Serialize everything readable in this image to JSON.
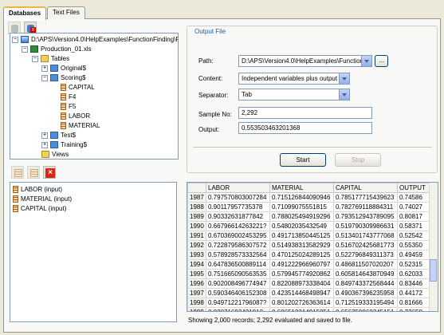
{
  "tabs": [
    {
      "label": "Databases",
      "active": true
    },
    {
      "label": "Text Files",
      "active": false
    }
  ],
  "tree": {
    "root": "D:\\APS\\Version4.0\\HelpExamples\\FunctionFinding\\Pro",
    "file": "Production_01.xls",
    "tables_label": "Tables",
    "tables": [
      "Original$",
      "Scoring$"
    ],
    "scoring_columns": [
      "CAPITAL",
      "F4",
      "F5",
      "LABOR",
      "MATERIAL"
    ],
    "more_tables": [
      "Test$",
      "Training$"
    ],
    "views_label": "Views"
  },
  "variables": [
    "LABOR (input)",
    "MATERIAL (input)",
    "CAPITAL (input)"
  ],
  "output_file": {
    "title": "Output File",
    "path_label": "Path:",
    "path_value": "D:\\APS\\Version4.0\\HelpExamples\\FunctionF",
    "browse_label": "...",
    "content_label": "Content:",
    "content_value": "Independent variables plus output",
    "separator_label": "Separator:",
    "separator_value": "Tab",
    "sample_label": "Sample No:",
    "sample_value": "2,292",
    "output_label": "Output:",
    "output_value": "0.553503463201368",
    "start_label": "Start",
    "stop_label": "Stop"
  },
  "grid": {
    "columns": [
      "",
      "LABOR",
      "MATERIAL",
      "CAPITAL",
      "OUTPUT"
    ],
    "rows": [
      [
        "1987",
        "0.797570803007284",
        "0.715126844090946",
        "0.785177715439623",
        "0.74586"
      ],
      [
        "1988",
        "0.90117957735378",
        "0.71099075551815",
        "0.782769118884311",
        "0.74027"
      ],
      [
        "1989",
        "0.90332631877842",
        "0.788025494919296",
        "0.793512943789095",
        "0.80817"
      ],
      [
        "1990",
        "0.66796614263221?",
        "0.54802035432549",
        "0.519790309986631",
        "0.58371"
      ],
      [
        "1991",
        "0.670369002453295",
        "0.491713850445125",
        "0.513401743777068",
        "0.52542"
      ],
      [
        "1992",
        "0.722879586307572",
        "0.514938313582929",
        "0.516702425681773",
        "0.55350"
      ],
      [
        "1993",
        "0.578928573332564",
        "0.470125024289125",
        "0.522796849311373",
        "0.49459"
      ],
      [
        "1994",
        "0.647836500889114",
        "0.491222966960797",
        "0.486811507020207",
        "0.52315"
      ],
      [
        "1995",
        "0.751665090563535",
        "0.579945774920862",
        "0.605814643870949",
        "0.62033"
      ],
      [
        "1996",
        "0.902008496774947",
        "0.822088973338404",
        "0.849743372568444",
        "0.83446"
      ],
      [
        "1997",
        "0.590346406152308",
        "0.423514468498947",
        "0.490367396235958",
        "0.44172"
      ],
      [
        "1998",
        "0.94971221796087?",
        "0.801202726363614",
        "0.712519333195494",
        "0.81666"
      ],
      [
        "1999",
        "0.8307169342181?",
        "0.686512314915851",
        "0.656759860245151",
        "0.73658"
      ]
    ]
  },
  "status": "Showing 2,000 records; 2,292 evaluated and saved to file."
}
